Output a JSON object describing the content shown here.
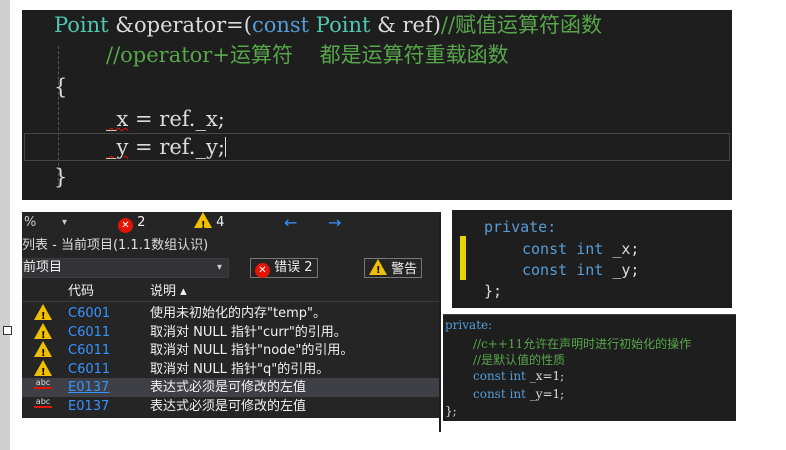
{
  "editor_top": {
    "line1": {
      "p1": "Point",
      "p2": " &operator=(",
      "p3": "const",
      "p4": " Point",
      "p5": " & ref)",
      "p6": "//赋值运算符函数"
    },
    "line2": "//operator+运算符    都是运算符重载函数",
    "line3": "{",
    "line4": {
      "v": "_x",
      "rest": " = ref._x;"
    },
    "line5": {
      "v": "_y",
      "rest": " = ref._y;"
    },
    "line6": "}"
  },
  "error_list": {
    "toolbar": {
      "zoom": "%",
      "error_count": "2",
      "warning_count": "4",
      "back_arrow": "←",
      "forward_arrow": "→"
    },
    "title": "列表 - 当前项目(1.1.1数组认识)",
    "scope_value": "前项目",
    "filter_errors": "错误 2",
    "filter_warnings": "警告",
    "columns": {
      "code": "代码",
      "desc": "说明"
    },
    "rows": [
      {
        "icon": "warning-icon",
        "code": "C6001",
        "desc": "使用未初始化的内存\"temp\"。"
      },
      {
        "icon": "warning-icon",
        "code": "C6011",
        "desc": "取消对 NULL 指针\"curr\"的引用。"
      },
      {
        "icon": "warning-icon",
        "code": "C6011",
        "desc": "取消对 NULL 指针\"node\"的引用。"
      },
      {
        "icon": "warning-icon",
        "code": "C6011",
        "desc": "取消对 NULL 指针\"q\"的引用。"
      },
      {
        "icon": "abc-error-icon",
        "code": "E0137",
        "desc": "表达式必须是可修改的左值"
      },
      {
        "icon": "abc-error-icon",
        "code": "E0137",
        "desc": "表达式必须是可修改的左值"
      }
    ]
  },
  "editor_mid": {
    "l1": "private:",
    "l2": {
      "kw1": "const",
      "kw2": "int",
      "v": "_x;"
    },
    "l3": {
      "kw1": "const",
      "kw2": "int",
      "v": "_y;"
    },
    "l4": "};"
  },
  "editor_bottom": {
    "l1": "private:",
    "l2": "//c++11允许在声明时进行初始化的操作",
    "l3": "//是默认值的性质",
    "l4": {
      "kw1": "const",
      "kw2": "int",
      "v": "_x=1;"
    },
    "l5": {
      "kw1": "const",
      "kw2": "int",
      "v": "_y=1;"
    },
    "l6": "};"
  },
  "colors": {
    "keyword": "#569cd6",
    "type": "#4ec9b0",
    "comment": "#57a64a",
    "text": "#dcdcdc",
    "error": "#e51400",
    "warning": "#f0c000",
    "link": "#3794ff"
  }
}
